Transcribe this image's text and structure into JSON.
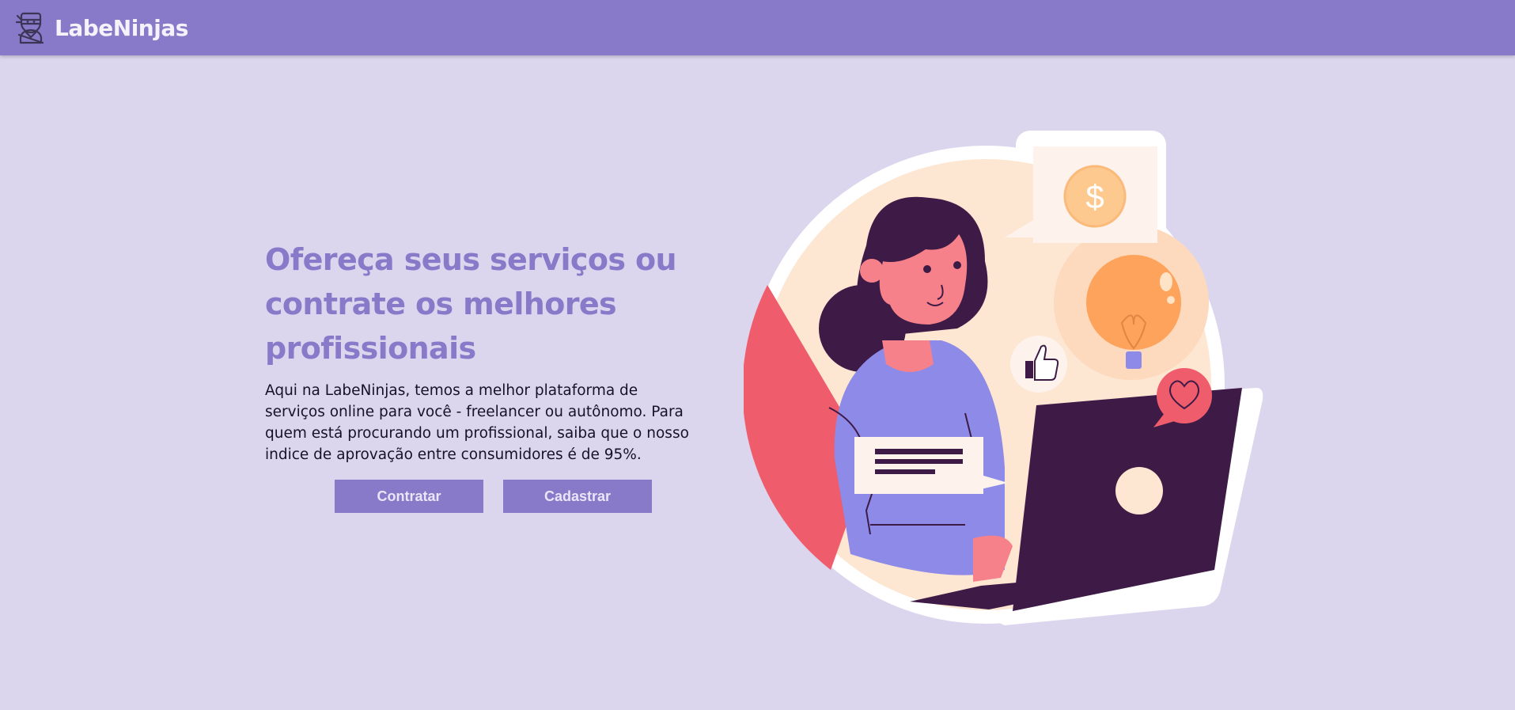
{
  "app": {
    "name": "LabeNinjas",
    "logo_icon": "ninja-icon"
  },
  "hero": {
    "title": "Ofereça seus serviços ou contrate os melhores profissionais",
    "description": "Aqui na LabeNinjas, temos a melhor plataforma de serviços online para você - freelancer ou autônomo. Para quem está procurando um profissional, saiba que o nosso indice de aprovação entre consumidores é de 95%.",
    "buttons": {
      "hire": "Contratar",
      "register": "Cadastrar"
    }
  },
  "illustration": {
    "dollar_symbol": "$",
    "icons": [
      "dollar-icon",
      "lightbulb-icon",
      "thumbs-up-icon",
      "heart-icon",
      "laptop-icon",
      "chat-bubble-icon"
    ]
  },
  "colors": {
    "header": "#8979c9",
    "background": "#dbd5ee",
    "accent": "#8979c9",
    "text": "#15122a"
  }
}
